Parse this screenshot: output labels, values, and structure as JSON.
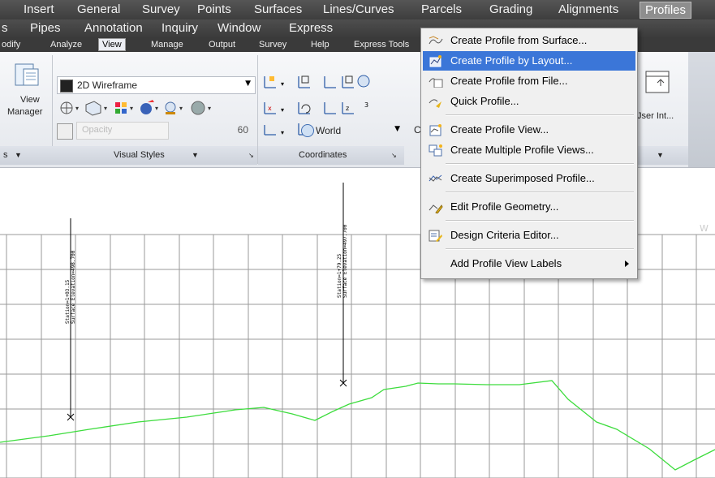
{
  "menubar_top": [
    "Insert",
    "General",
    "Survey",
    "Points",
    "Surfaces",
    "Lines/Curves",
    "Parcels",
    "Grading",
    "Alignments",
    "Profiles"
  ],
  "menubar_top_partial_left": "",
  "menubar_second": [
    "s",
    "Pipes",
    "Annotation",
    "Inquiry",
    "Window",
    "Express"
  ],
  "ribbon_tabs": [
    "odify",
    "Analyze",
    "View",
    "Manage",
    "Output",
    "Survey",
    "Help",
    "Express Tools"
  ],
  "ribbon_tab_active": "View",
  "ribbon": {
    "view_manager_label1": "View",
    "view_manager_label2": "Manager",
    "visual_style": "2D Wireframe",
    "opacity_label": "Opacity",
    "opacity_value": "60",
    "coordinates_world": "World",
    "visual_styles_panel": "Visual Styles",
    "coordinates_panel": "Coordinates",
    "left_panel": "s",
    "user_interface_label": "Jser Int...",
    "c_label": "C"
  },
  "dropdown": {
    "items": [
      {
        "label": "Create Profile from Surface...",
        "icon": "profile-surface-icon"
      },
      {
        "label": "Create Profile by Layout...",
        "icon": "profile-layout-icon",
        "highlighted": true
      },
      {
        "label": "Create Profile from File...",
        "icon": "profile-file-icon"
      },
      {
        "label": "Quick Profile...",
        "icon": "quick-profile-icon"
      },
      {
        "label": "Create Profile View...",
        "icon": "profile-view-icon"
      },
      {
        "label": "Create Multiple Profile Views...",
        "icon": "multiple-profile-views-icon"
      },
      {
        "label": "Create Superimposed Profile...",
        "icon": "superimposed-profile-icon"
      },
      {
        "label": "Edit Profile Geometry...",
        "icon": "edit-profile-geometry-icon"
      },
      {
        "label": "Design Criteria Editor...",
        "icon": "design-criteria-icon"
      },
      {
        "label": "Add Profile View Labels",
        "icon": "",
        "submenu": true
      }
    ]
  },
  "drawing": {
    "label_left_line1": "Station=1+03.15",
    "label_left_line2": "Surface Elevation=498.700",
    "label_mid_line1": "Station=1+79.25",
    "label_mid_line2": "Surface Elevation=497.700",
    "edge_mark": "W"
  },
  "colors": {
    "menubar": "#4a4a4a",
    "highlight": "#3b76d8",
    "profile_line": "#3ddc3d",
    "grid": "#9a9a9a"
  }
}
